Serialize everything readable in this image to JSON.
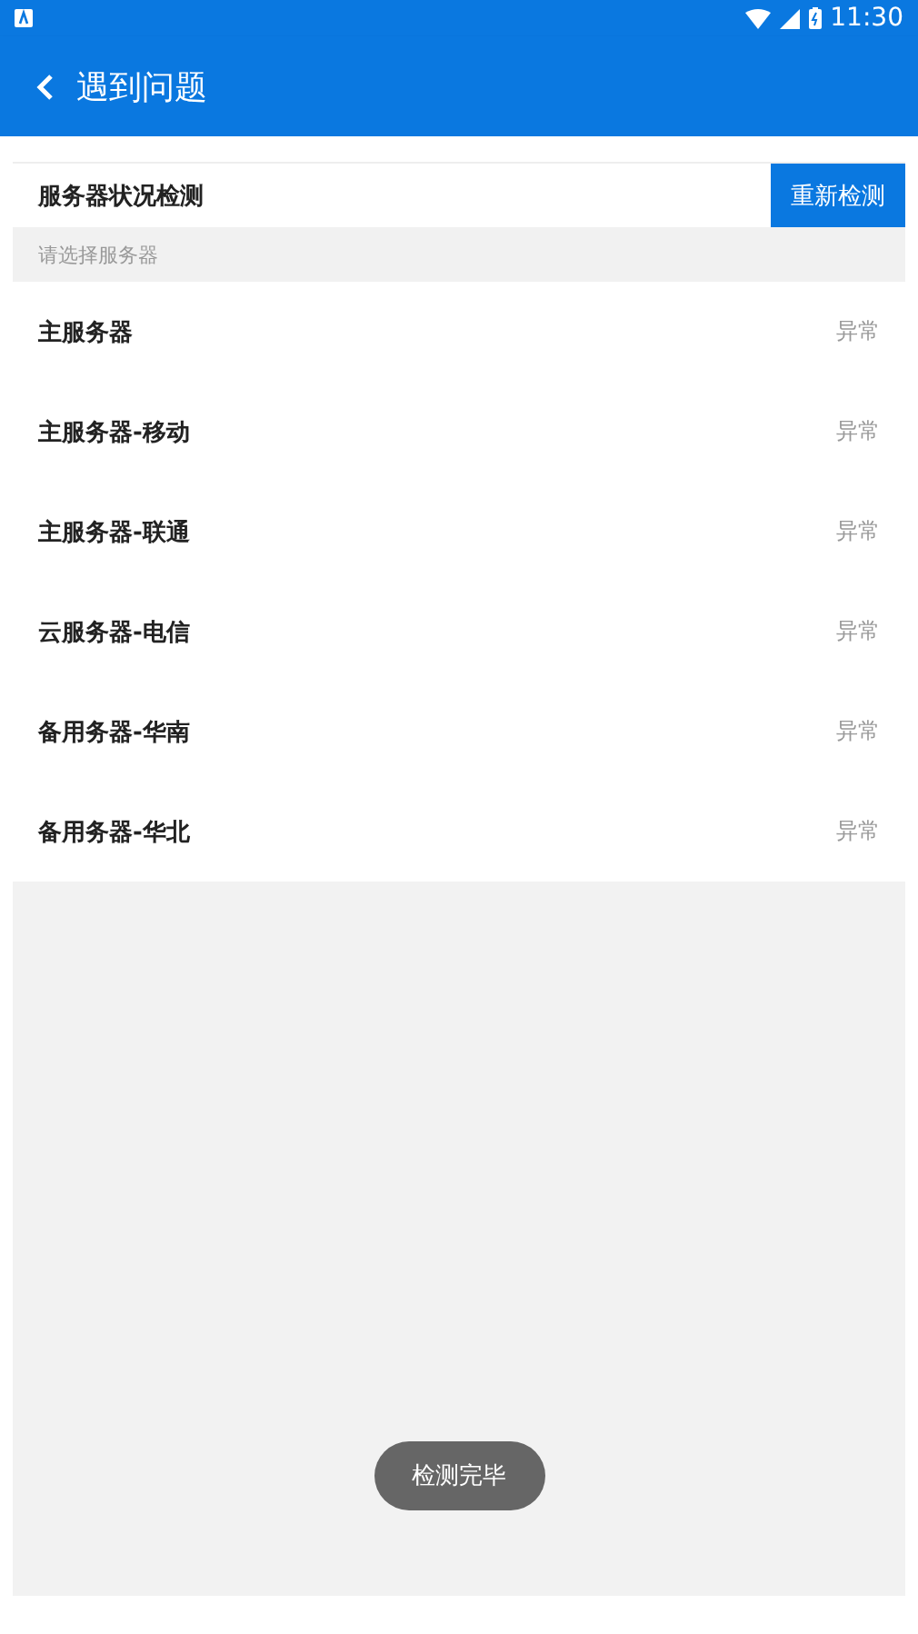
{
  "status_bar": {
    "time": "11:30"
  },
  "app_bar": {
    "title": "遇到问题"
  },
  "section": {
    "title": "服务器状况检测",
    "button": "重新检测",
    "hint": "请选择服务器"
  },
  "servers": [
    {
      "name": "主服务器",
      "status": "异常"
    },
    {
      "name": "主服务器-移动",
      "status": "异常"
    },
    {
      "name": "主服务器-联通",
      "status": "异常"
    },
    {
      "name": "云服务器-电信",
      "status": "异常"
    },
    {
      "name": "备用务器-华南",
      "status": "异常"
    },
    {
      "name": "备用务器-华北",
      "status": "异常"
    }
  ],
  "toast": "检测完毕"
}
